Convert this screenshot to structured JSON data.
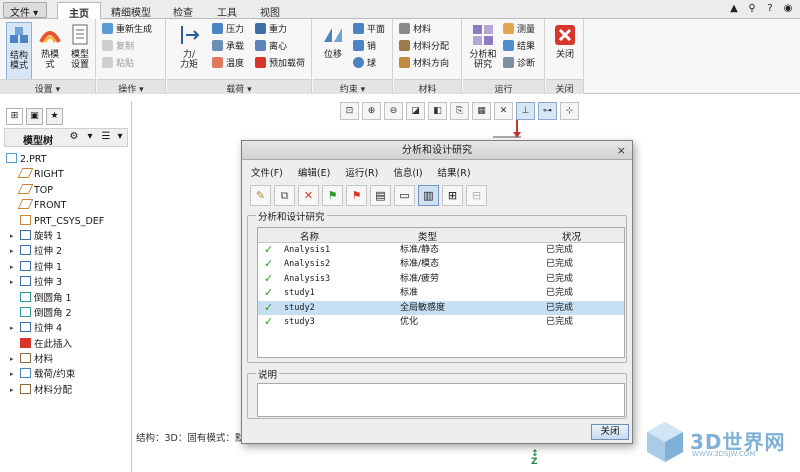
{
  "menu_tabs": {
    "file": "文件 ▾",
    "tabs": [
      "主页",
      "精细模型",
      "检查",
      "工具",
      "视图"
    ]
  },
  "ribbon": {
    "settings": {
      "label": "设置 ▾",
      "structure_model": "结构\n模式",
      "thermal_model": "热模\n式",
      "model_setup": "模型\n设置"
    },
    "operations": {
      "label": "操作 ▾",
      "regenerate": "重新生成",
      "copy": "复制",
      "paste": "粘贴"
    },
    "loads": {
      "label": "载荷 ▾",
      "force_moment": "力/\n力矩",
      "pressure": "压力",
      "bearing": "承载",
      "temperature": "温度",
      "gravity": "重力",
      "centrifugal": "离心",
      "preload": "预加载荷"
    },
    "constraints": {
      "label": "约束 ▾",
      "displacement": "位移",
      "plane": "平面",
      "pin": "销",
      "ball": "球"
    },
    "material": {
      "label": "材料",
      "material": "材料",
      "assignment": "材料分配",
      "orientation": "材料方向"
    },
    "run": {
      "label": "运行",
      "analysis": "分析和\n研究",
      "measure": "测量",
      "results": "结果",
      "diagnose": "诊断"
    },
    "close": {
      "label": "关闭",
      "close": "关闭"
    }
  },
  "model_tree": {
    "title": "模型树",
    "items": [
      {
        "label": "2.PRT",
        "icon": "part-icon",
        "expand": ""
      },
      {
        "label": "RIGHT",
        "icon": "datum-plane-icon",
        "expand": ""
      },
      {
        "label": "TOP",
        "icon": "datum-plane-icon",
        "expand": ""
      },
      {
        "label": "FRONT",
        "icon": "datum-plane-icon",
        "expand": ""
      },
      {
        "label": "PRT_CSYS_DEF",
        "icon": "csys-icon",
        "expand": ""
      },
      {
        "label": "旋转 1",
        "icon": "revolve-icon",
        "expand": "▸"
      },
      {
        "label": "拉伸 2",
        "icon": "extrude-icon",
        "expand": "▸"
      },
      {
        "label": "拉伸 1",
        "icon": "extrude-icon",
        "expand": "▸"
      },
      {
        "label": "拉伸 3",
        "icon": "extrude-icon",
        "expand": "▸"
      },
      {
        "label": "倒圆角 1",
        "icon": "round-icon",
        "expand": ""
      },
      {
        "label": "倒圆角 2",
        "icon": "round-icon",
        "expand": ""
      },
      {
        "label": "拉伸 4",
        "icon": "extrude-icon",
        "expand": "▸"
      },
      {
        "label": "在此插入",
        "icon": "insert-arrow-icon",
        "expand": ""
      },
      {
        "label": "材料",
        "icon": "material-icon",
        "expand": "▸"
      },
      {
        "label": "载荷/约束",
        "icon": "load-icon",
        "expand": "▸"
      },
      {
        "label": "材料分配",
        "icon": "material-assign-icon",
        "expand": "▸"
      }
    ]
  },
  "status_text": "结构：3D：固有模式：默",
  "axis_label": "Z",
  "dialog": {
    "title": "分析和设计研究",
    "menu": [
      "文件(F)",
      "编辑(E)",
      "运行(R)",
      "信息(I)",
      "结果(R)"
    ],
    "group_label": "分析和设计研究",
    "columns": [
      "名称",
      "类型",
      "状况"
    ],
    "rows": [
      {
        "name": "Analysis1",
        "type": "标准/静态",
        "status": "已完成",
        "selected": false
      },
      {
        "name": "Analysis2",
        "type": "标准/模态",
        "status": "已完成",
        "selected": false
      },
      {
        "name": "Analysis3",
        "type": "标准/疲劳",
        "status": "已完成",
        "selected": false
      },
      {
        "name": "study1",
        "type": "标准",
        "status": "已完成",
        "selected": false
      },
      {
        "name": "study2",
        "type": "全局敏感度",
        "status": "已完成",
        "selected": true
      },
      {
        "name": "study3",
        "type": "优化",
        "status": "已完成",
        "selected": false
      }
    ],
    "description_label": "说明",
    "description_value": "",
    "close_button": "关闭"
  },
  "watermark": {
    "text": "3D世界网",
    "url": "WWW.3DSJW.COM"
  },
  "colors": {
    "accent": "#2b6cb0",
    "check": "#2e9a2b",
    "selected_row": "#c6dff3",
    "close_red": "#d9362b"
  }
}
